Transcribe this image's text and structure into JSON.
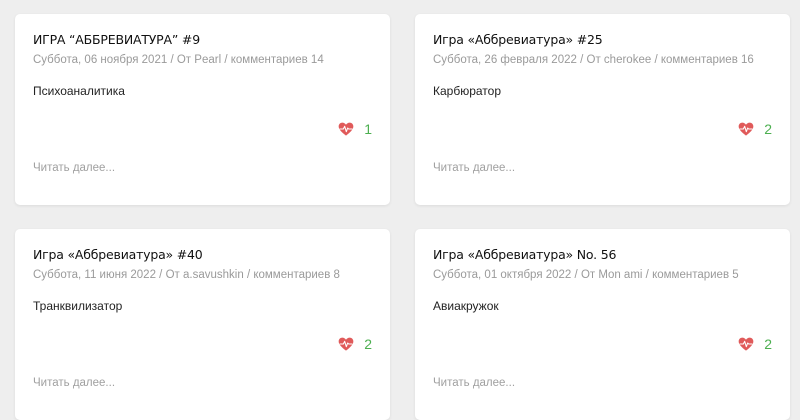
{
  "posts": [
    {
      "title": "ИГРА “АББРЕВИАТУРА” #9",
      "date": "Суббота, 06 ноября 2021",
      "author_prefix": "От",
      "author": "Pearl",
      "comments": "комментариев 14",
      "text": "Психоаналитика",
      "likes": "1",
      "read_more": "Читать далее..."
    },
    {
      "title": "Игра «Аббревиатура» #25",
      "date": "Суббота, 26 февраля 2022",
      "author_prefix": "От",
      "author": "cherokee",
      "comments": "комментариев 16",
      "text": "Карбюратор",
      "likes": "2",
      "read_more": "Читать далее..."
    },
    {
      "title": "Игра «Аббревиатура» #40",
      "date": "Суббота, 11 июня 2022",
      "author_prefix": "От",
      "author": "a.savushkin",
      "comments": "комментариев 8",
      "text": "Транквилизатор",
      "likes": "2",
      "read_more": "Читать далее..."
    },
    {
      "title": "Игра «Аббревиатура» No. 56",
      "date": "Суббота, 01 октября 2022",
      "author_prefix": "От",
      "author": "Mon ami",
      "comments": "комментариев 5",
      "text": "Авиакружок",
      "likes": "2",
      "read_more": "Читать далее..."
    }
  ],
  "separator": "/",
  "icons": {
    "like": "heart-pulse-icon"
  },
  "colors": {
    "heart": "#e05a5a",
    "like_count": "#4caf50",
    "meta": "#9a9a9a"
  }
}
